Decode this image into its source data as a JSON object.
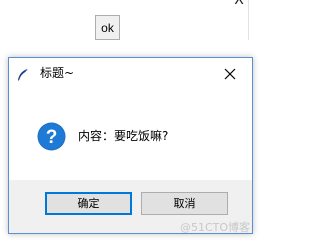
{
  "main": {
    "ok_button_label": "ok",
    "background_close_glyph": "X"
  },
  "dialog": {
    "title": "标题~",
    "title_icon": "feather-icon",
    "close_icon": "close-icon",
    "message_icon": "question-icon",
    "message": "内容：要吃饭嘛?",
    "buttons": {
      "confirm_label": "确定",
      "cancel_label": "取消"
    }
  },
  "watermark": {
    "text": "@51CTO博客"
  },
  "colors": {
    "accent": "#0078d7",
    "dialog_border": "#5a8fd6",
    "footer_bg": "#f0f0f0",
    "question_icon_bg": "#1a6fc4"
  }
}
